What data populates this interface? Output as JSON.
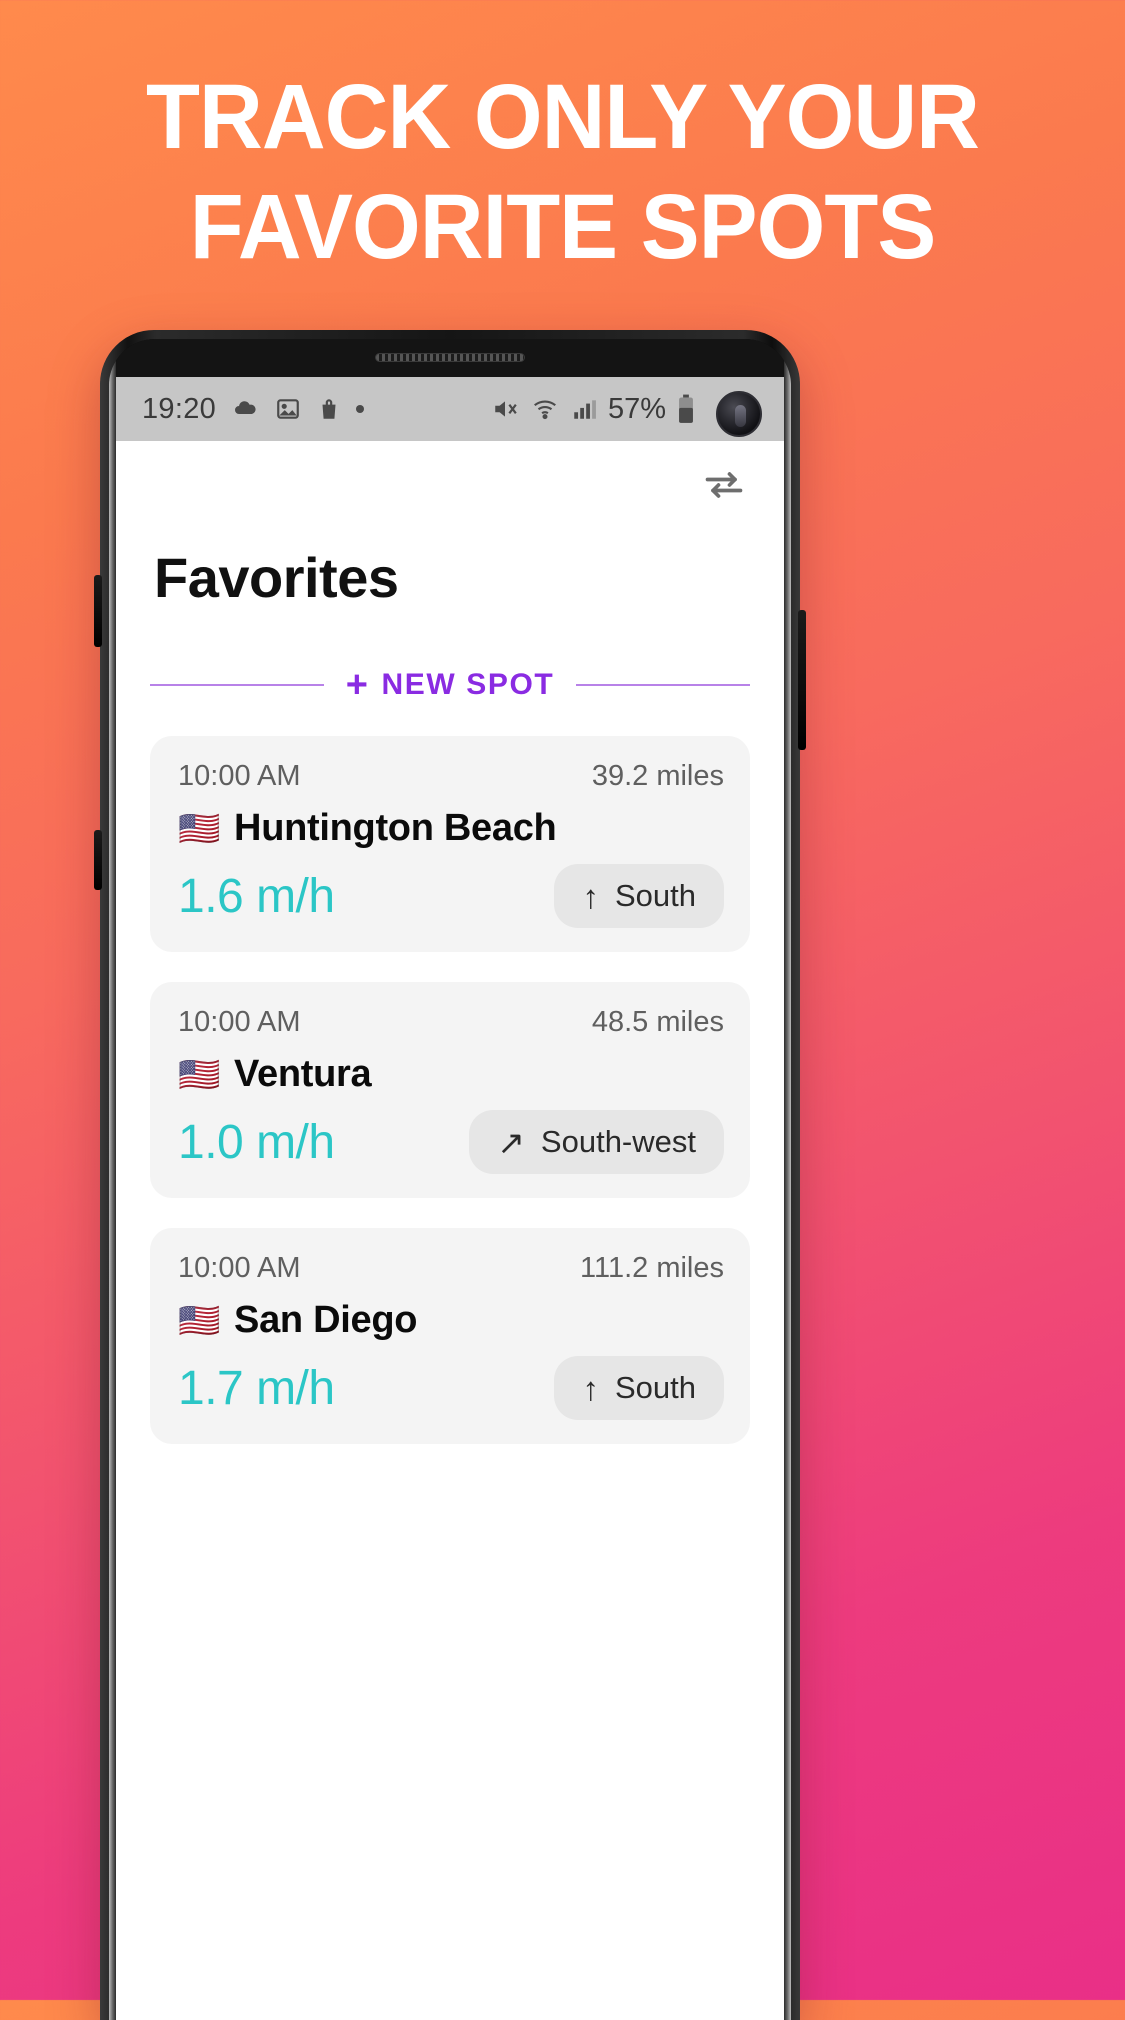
{
  "promo": {
    "headline_line1": "TRACK ONLY YOUR",
    "headline_line2": "FAVORITE SPOTS",
    "background_start": "#FF8A4C",
    "background_end": "#E92F87"
  },
  "statusbar": {
    "time": "19:20",
    "battery_percent": "57%",
    "icons_left": [
      "cloud-icon",
      "image-icon",
      "shopping-bag-icon",
      "dot-icon"
    ],
    "icons_right": [
      "mute-icon",
      "wifi-icon",
      "signal-icon",
      "battery-icon"
    ]
  },
  "app": {
    "title": "Favorites",
    "swap_icon": "swap-units-icon",
    "new_spot": {
      "label": "NEW SPOT",
      "plus": "+",
      "accent_color": "#8A2BE2"
    },
    "speed_color": "#2BC6C6",
    "cards": [
      {
        "time": "10:00 AM",
        "distance": "39.2 miles",
        "flag": "🇺🇸",
        "name": "Huntington Beach",
        "speed": "1.6 m/h",
        "direction": "South",
        "direction_arrow": "↑"
      },
      {
        "time": "10:00 AM",
        "distance": "48.5 miles",
        "flag": "🇺🇸",
        "name": "Ventura",
        "speed": "1.0 m/h",
        "direction": "South-west",
        "direction_arrow": "↗"
      },
      {
        "time": "10:00 AM",
        "distance": "111.2 miles",
        "flag": "🇺🇸",
        "name": "San Diego",
        "speed": "1.7 m/h",
        "direction": "South",
        "direction_arrow": "↑"
      }
    ]
  }
}
